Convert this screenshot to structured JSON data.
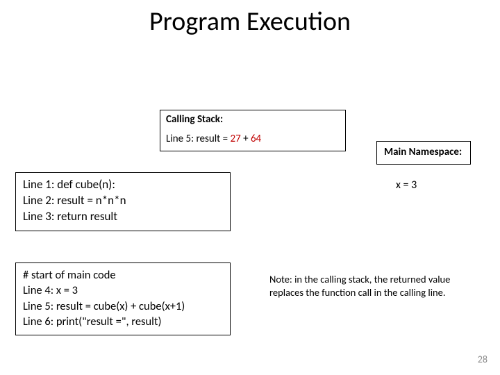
{
  "title": "Program Execution",
  "calling_stack": {
    "label": "Calling Stack:",
    "line_prefix": "Line 5: result = ",
    "val1": "27",
    "plus": " + ",
    "val2": "64"
  },
  "namespace_label": "Main Namespace:",
  "x_line": "x = 3",
  "code1": {
    "l1": "Line 1:  def cube(n):",
    "l2": "Line 2:       result = n*n*n",
    "l3": "Line 3:       return result"
  },
  "code2": {
    "c0": "# start of main code",
    "l4": "Line 4:  x = 3",
    "l5": "Line 5:  result = cube(x) + cube(x+1)",
    "l6": "Line 6:  print(\"result =\", result)"
  },
  "note": "Note: in the calling stack, the returned value replaces the function call in the calling line.",
  "page_number": "28"
}
